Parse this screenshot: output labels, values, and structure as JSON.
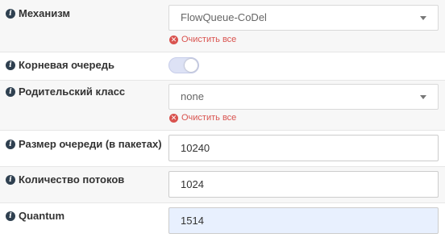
{
  "mechanism": {
    "label": "Механизм",
    "value": "FlowQueue-CoDel",
    "clear_label": "Очистить все"
  },
  "root_queue": {
    "label": "Корневая очередь",
    "enabled": true
  },
  "parent_class": {
    "label": "Родительский класс",
    "value": "none",
    "clear_label": "Очистить все"
  },
  "queue_size": {
    "label": "Размер очереди (в пакетах)",
    "value": "10240"
  },
  "flows": {
    "label": "Количество потоков",
    "value": "1024"
  },
  "quantum": {
    "label": "Quantum",
    "value": "1514"
  },
  "colors": {
    "clear_red": "#d9534f",
    "info_icon": "#2f4050",
    "focused_input_bg": "#e8f0fe"
  }
}
